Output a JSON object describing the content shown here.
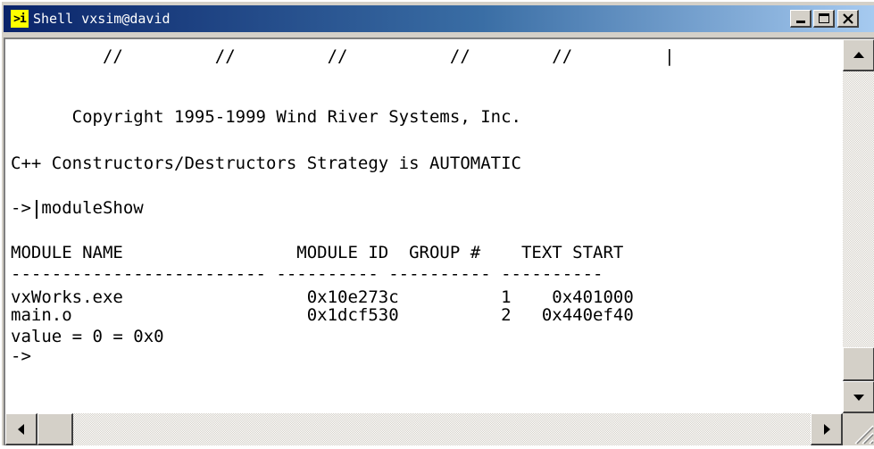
{
  "window": {
    "title": "Shell vxsim@david",
    "icon": "shell-terminal-icon",
    "title_colors": {
      "active_start": "#0a246a",
      "active_end": "#a6caf0"
    }
  },
  "caption_buttons": {
    "minimize": "minimize-icon",
    "maximize": "maximize-icon",
    "close": "close-icon"
  },
  "terminal": {
    "lines": [
      "         //         //         //          //        //         |",
      "",
      "      Copyright 1995-1999 Wind River Systems, Inc.",
      "",
      "C++ Constructors/Destructors Strategy is AUTOMATIC",
      "",
      "-> moduleShow",
      "",
      "MODULE NAME                 MODULE ID  GROUP #    TEXT START",
      "------------------------- ---------- ---------- ----------",
      "vxWorks.exe                  0x10e273c          1    0x401000",
      "main.o                       0x1dcf530          2   0x440ef40",
      "value = 0 = 0x0",
      "->"
    ]
  },
  "scrollbars": {
    "vertical": {
      "up": "up-arrow-icon",
      "down": "down-arrow-icon",
      "position": 0.92
    },
    "horizontal": {
      "left": "left-arrow-icon",
      "right": "right-arrow-icon",
      "position": 0.0
    }
  }
}
